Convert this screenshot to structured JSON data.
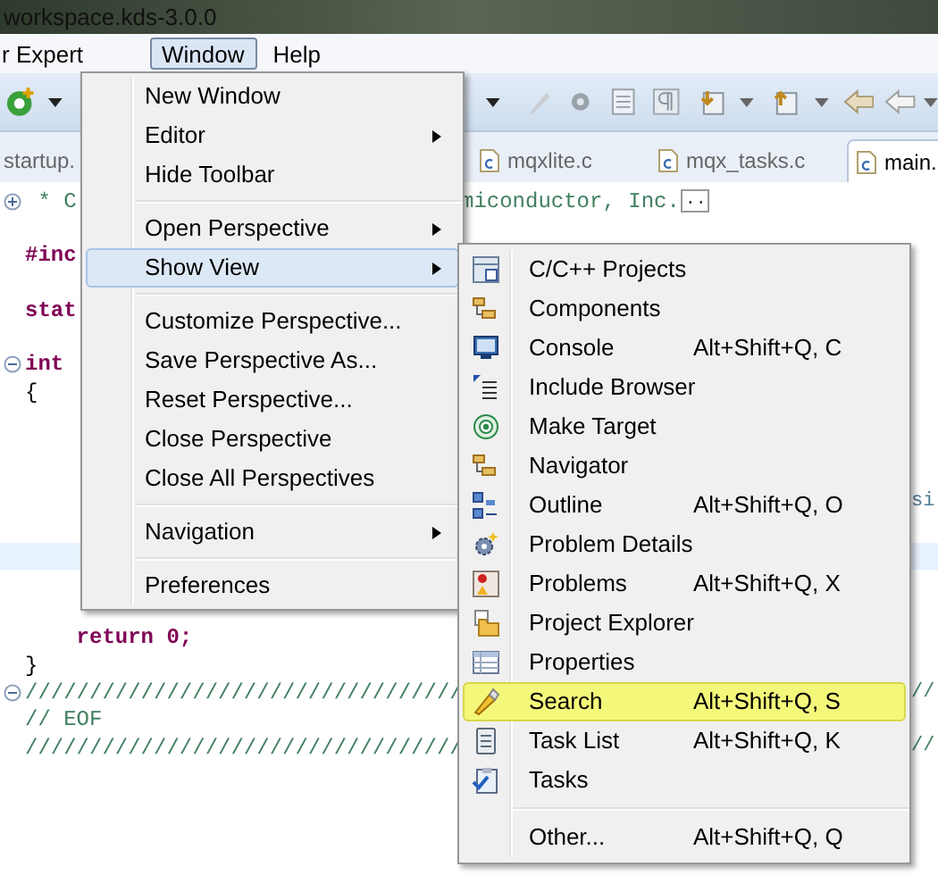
{
  "window": {
    "title": "workspace.kds-3.0.0"
  },
  "menu_bar": [
    {
      "label": "r Expert",
      "selected": false
    },
    {
      "label": "Window",
      "selected": true
    },
    {
      "label": "Help",
      "selected": false
    }
  ],
  "tabs": [
    {
      "label": "startup.",
      "selected": false
    },
    {
      "label": "mqxlite.c",
      "selected": false
    },
    {
      "label": "mqx_tasks.c",
      "selected": false
    },
    {
      "label": "main.",
      "selected": true
    }
  ],
  "editor": {
    "lines": [
      {
        "kind": "comment",
        "collapsed": true,
        "current": false,
        "left": " * C",
        "right": "miconductor, Inc.",
        "folded_marker": ".."
      },
      {
        "current": false
      },
      {
        "kind": "keyword",
        "current": false,
        "left": "#inc"
      },
      {
        "current": false
      },
      {
        "kind": "keyword",
        "current": false,
        "left": "stat"
      },
      {
        "current": false
      },
      {
        "kind": "keyword",
        "collapsed": false,
        "current": false,
        "left": "int"
      },
      {
        "kind": "plain",
        "current": false,
        "left": "{"
      },
      {
        "current": false
      },
      {
        "current": false
      },
      {
        "current": false
      },
      {
        "kind": "string",
        "current": false,
        "tail": "si"
      },
      {
        "current": false
      },
      {
        "current": true
      },
      {
        "current": false
      },
      {
        "current": false
      },
      {
        "kind": "keyword",
        "current": false,
        "left": "    return 0;"
      },
      {
        "kind": "plain",
        "current": false,
        "left": "}"
      },
      {
        "kind": "comment",
        "collapsed": false,
        "current": false,
        "left": "//////////////////////////////////",
        "tail": "//"
      },
      {
        "kind": "comment",
        "current": false,
        "left": "// EOF"
      },
      {
        "kind": "comment",
        "current": false,
        "left": "//////////////////////////////////",
        "tail": "//"
      }
    ]
  },
  "window_menu": {
    "groups": [
      [
        {
          "label": "New Window",
          "submenu": false,
          "selected": false
        },
        {
          "label": "Editor",
          "submenu": true,
          "selected": false
        },
        {
          "label": "Hide Toolbar",
          "submenu": false,
          "selected": false
        }
      ],
      [
        {
          "label": "Open Perspective",
          "submenu": true,
          "selected": false
        },
        {
          "label": "Show View",
          "submenu": true,
          "selected": true
        }
      ],
      [
        {
          "label": "Customize Perspective...",
          "submenu": false,
          "selected": false
        },
        {
          "label": "Save Perspective As...",
          "submenu": false,
          "selected": false
        },
        {
          "label": "Reset Perspective...",
          "submenu": false,
          "selected": false
        },
        {
          "label": "Close Perspective",
          "submenu": false,
          "selected": false
        },
        {
          "label": "Close All Perspectives",
          "submenu": false,
          "selected": false
        }
      ],
      [
        {
          "label": "Navigation",
          "submenu": true,
          "selected": false
        }
      ],
      [
        {
          "label": "Preferences",
          "submenu": false,
          "selected": false
        }
      ]
    ]
  },
  "show_view_menu": {
    "groups": [
      [
        {
          "label": "C/C++ Projects",
          "selected": false
        },
        {
          "label": "Components",
          "selected": false
        },
        {
          "label": "Console",
          "shortcut": "Alt+Shift+Q, C",
          "selected": false
        },
        {
          "label": "Include Browser",
          "selected": false
        },
        {
          "label": "Make Target",
          "selected": false
        },
        {
          "label": "Navigator",
          "selected": false
        },
        {
          "label": "Outline",
          "shortcut": "Alt+Shift+Q, O",
          "selected": false
        },
        {
          "label": "Problem Details",
          "selected": false
        },
        {
          "label": "Problems",
          "shortcut": "Alt+Shift+Q, X",
          "selected": false
        },
        {
          "label": "Project Explorer",
          "selected": false
        },
        {
          "label": "Properties",
          "selected": false
        },
        {
          "label": "Search",
          "shortcut": "Alt+Shift+Q, S",
          "selected": true
        },
        {
          "label": "Task List",
          "shortcut": "Alt+Shift+Q, K",
          "selected": false
        },
        {
          "label": "Tasks",
          "selected": false
        }
      ],
      [
        {
          "label": "Other...",
          "shortcut": "Alt+Shift+Q, Q",
          "selected": false
        }
      ]
    ]
  }
}
